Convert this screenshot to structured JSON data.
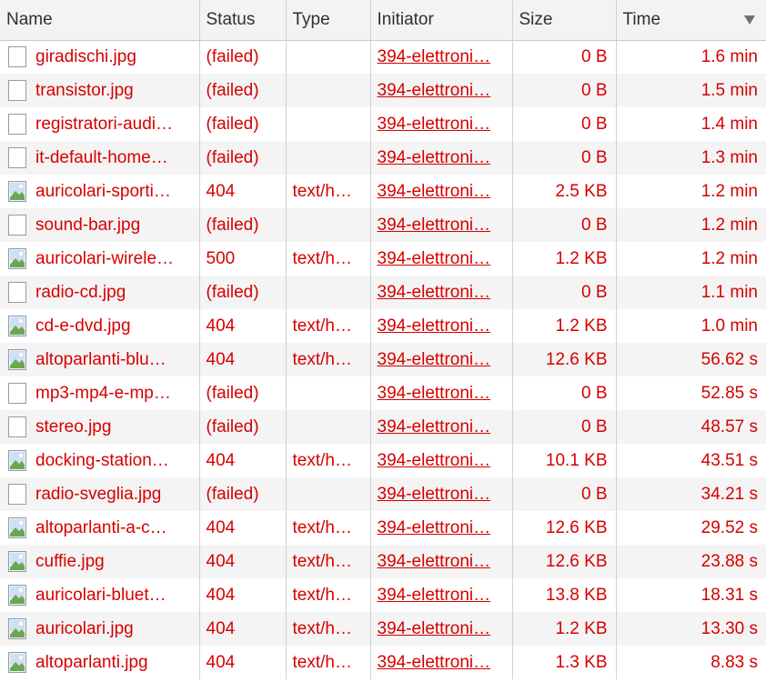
{
  "columns": {
    "name": "Name",
    "status": "Status",
    "type": "Type",
    "initiator": "Initiator",
    "size": "Size",
    "time": "Time"
  },
  "sort": {
    "column": "time",
    "direction": "descending"
  },
  "colors": {
    "error_text": "#d60000",
    "header_bg": "#f3f3f3",
    "stripe_bg": "#f4f4f4"
  },
  "rows": [
    {
      "icon": "document-icon",
      "name": "giradischi.jpg",
      "status": "(failed)",
      "type": "",
      "initiator": "394-elettroni…",
      "size": "0 B",
      "time": "1.6 min"
    },
    {
      "icon": "document-icon",
      "name": "transistor.jpg",
      "status": "(failed)",
      "type": "",
      "initiator": "394-elettroni…",
      "size": "0 B",
      "time": "1.5 min"
    },
    {
      "icon": "document-icon",
      "name": "registratori-audi…",
      "status": "(failed)",
      "type": "",
      "initiator": "394-elettroni…",
      "size": "0 B",
      "time": "1.4 min"
    },
    {
      "icon": "document-icon",
      "name": "it-default-home…",
      "status": "(failed)",
      "type": "",
      "initiator": "394-elettroni…",
      "size": "0 B",
      "time": "1.3 min"
    },
    {
      "icon": "image-icon",
      "name": "auricolari-sporti…",
      "status": "404",
      "type": "text/h…",
      "initiator": "394-elettroni…",
      "size": "2.5 KB",
      "time": "1.2 min"
    },
    {
      "icon": "document-icon",
      "name": "sound-bar.jpg",
      "status": "(failed)",
      "type": "",
      "initiator": "394-elettroni…",
      "size": "0 B",
      "time": "1.2 min"
    },
    {
      "icon": "image-icon",
      "name": "auricolari-wirele…",
      "status": "500",
      "type": "text/h…",
      "initiator": "394-elettroni…",
      "size": "1.2 KB",
      "time": "1.2 min"
    },
    {
      "icon": "document-icon",
      "name": "radio-cd.jpg",
      "status": "(failed)",
      "type": "",
      "initiator": "394-elettroni…",
      "size": "0 B",
      "time": "1.1 min"
    },
    {
      "icon": "image-icon",
      "name": "cd-e-dvd.jpg",
      "status": "404",
      "type": "text/h…",
      "initiator": "394-elettroni…",
      "size": "1.2 KB",
      "time": "1.0 min"
    },
    {
      "icon": "image-icon",
      "name": "altoparlanti-blu…",
      "status": "404",
      "type": "text/h…",
      "initiator": "394-elettroni…",
      "size": "12.6 KB",
      "time": "56.62 s"
    },
    {
      "icon": "document-icon",
      "name": "mp3-mp4-e-mp…",
      "status": "(failed)",
      "type": "",
      "initiator": "394-elettroni…",
      "size": "0 B",
      "time": "52.85 s"
    },
    {
      "icon": "document-icon",
      "name": "stereo.jpg",
      "status": "(failed)",
      "type": "",
      "initiator": "394-elettroni…",
      "size": "0 B",
      "time": "48.57 s"
    },
    {
      "icon": "image-icon",
      "name": "docking-station…",
      "status": "404",
      "type": "text/h…",
      "initiator": "394-elettroni…",
      "size": "10.1 KB",
      "time": "43.51 s"
    },
    {
      "icon": "document-icon",
      "name": "radio-sveglia.jpg",
      "status": "(failed)",
      "type": "",
      "initiator": "394-elettroni…",
      "size": "0 B",
      "time": "34.21 s"
    },
    {
      "icon": "image-icon",
      "name": "altoparlanti-a-c…",
      "status": "404",
      "type": "text/h…",
      "initiator": "394-elettroni…",
      "size": "12.6 KB",
      "time": "29.52 s"
    },
    {
      "icon": "image-icon",
      "name": "cuffie.jpg",
      "status": "404",
      "type": "text/h…",
      "initiator": "394-elettroni…",
      "size": "12.6 KB",
      "time": "23.88 s"
    },
    {
      "icon": "image-icon",
      "name": "auricolari-bluet…",
      "status": "404",
      "type": "text/h…",
      "initiator": "394-elettroni…",
      "size": "13.8 KB",
      "time": "18.31 s"
    },
    {
      "icon": "image-icon",
      "name": "auricolari.jpg",
      "status": "404",
      "type": "text/h…",
      "initiator": "394-elettroni…",
      "size": "1.2 KB",
      "time": "13.30 s"
    },
    {
      "icon": "image-icon",
      "name": "altoparlanti.jpg",
      "status": "404",
      "type": "text/h…",
      "initiator": "394-elettroni…",
      "size": "1.3 KB",
      "time": "8.83 s"
    }
  ]
}
